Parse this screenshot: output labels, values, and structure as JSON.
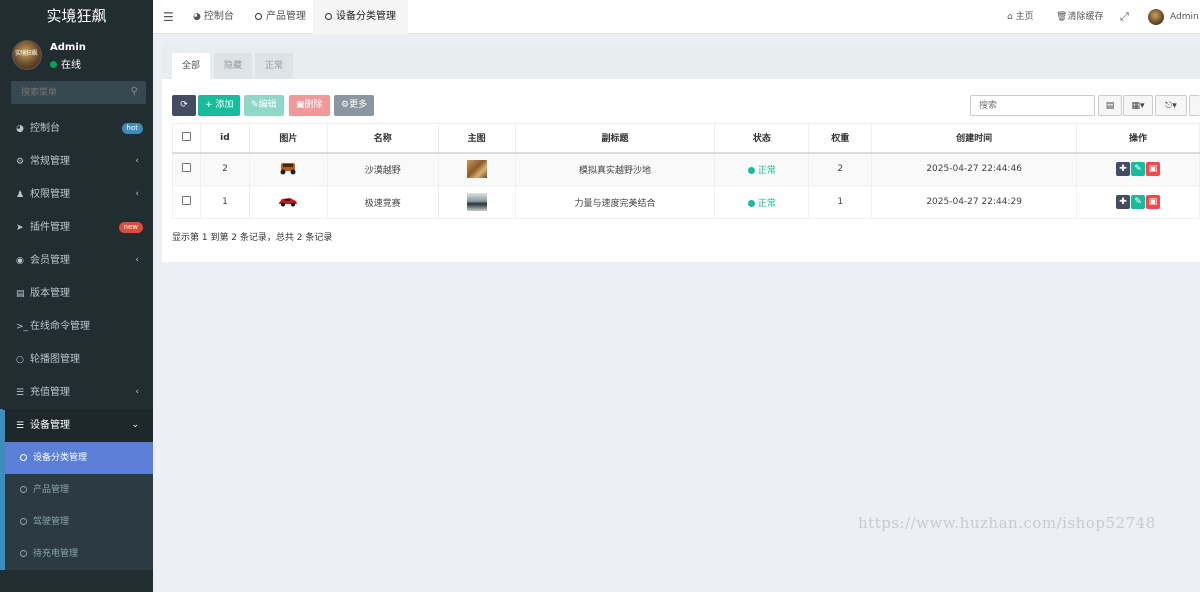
{
  "app": {
    "title": "实境狂飙"
  },
  "user": {
    "name": "Admin",
    "status": "在线",
    "avatar_text": "实境狂飙"
  },
  "search": {
    "placeholder": "搜索菜单"
  },
  "sidebar": {
    "items": [
      {
        "label": "控制台",
        "icon": "dashboard-icon",
        "badge": "hot"
      },
      {
        "label": "常规管理",
        "icon": "cogs-icon",
        "arrow": "‹"
      },
      {
        "label": "权限管理",
        "icon": "users-icon",
        "arrow": "‹"
      },
      {
        "label": "插件管理",
        "icon": "rocket-icon",
        "badge": "new"
      },
      {
        "label": "会员管理",
        "icon": "user-circle-icon",
        "arrow": "‹"
      },
      {
        "label": "版本管理",
        "icon": "file-icon"
      },
      {
        "label": "在线命令管理",
        "icon": "terminal-icon"
      },
      {
        "label": "轮播图管理",
        "icon": "circle-icon"
      },
      {
        "label": "充值管理",
        "icon": "list-icon",
        "arrow": "‹"
      },
      {
        "label": "设备管理",
        "icon": "list-icon",
        "arrow": "⌄"
      }
    ],
    "sub_items": [
      {
        "label": "设备分类管理",
        "active": true
      },
      {
        "label": "产品管理"
      },
      {
        "label": "驾驶管理"
      },
      {
        "label": "待充电管理"
      }
    ]
  },
  "topbar": {
    "tabs": [
      {
        "label": "控制台",
        "icon": "dashboard-icon"
      },
      {
        "label": "产品管理",
        "icon": "circle-icon"
      },
      {
        "label": "设备分类管理",
        "icon": "circle-icon",
        "active": true
      }
    ],
    "home_label": "主页",
    "clear_cache_label": "清除缓存",
    "admin_label": "Admin"
  },
  "panel": {
    "tabs": [
      "全部",
      "隐藏",
      "正常"
    ],
    "buttons": {
      "add": "添加",
      "edit": "编辑",
      "delete": "删除",
      "more": "更多"
    },
    "search_placeholder": "搜索"
  },
  "table": {
    "headers": [
      "id",
      "图片",
      "名称",
      "主图",
      "副标题",
      "状态",
      "权重",
      "创建时间",
      "操作"
    ],
    "rows": [
      {
        "id": "2",
        "name": "沙漠越野",
        "subtitle": "模拟真实越野沙地",
        "status": "正常",
        "weight": "2",
        "created": "2025-04-27 22:44:46",
        "car_color": "#b0601a"
      },
      {
        "id": "1",
        "name": "极速竞赛",
        "subtitle": "力量与速度完美结合",
        "status": "正常",
        "weight": "1",
        "created": "2025-04-27 22:44:29",
        "car_color": "#d01818"
      }
    ],
    "summary": "显示第 1 到第 2 条记录，总共 2 条记录"
  },
  "watermark": "https://www.huzhan.com/ishop52748",
  "colors": {
    "sidebar_bg": "#222d32",
    "accent": "#5b7fd6",
    "success": "#18bc9c",
    "danger": "#f04a4a"
  }
}
